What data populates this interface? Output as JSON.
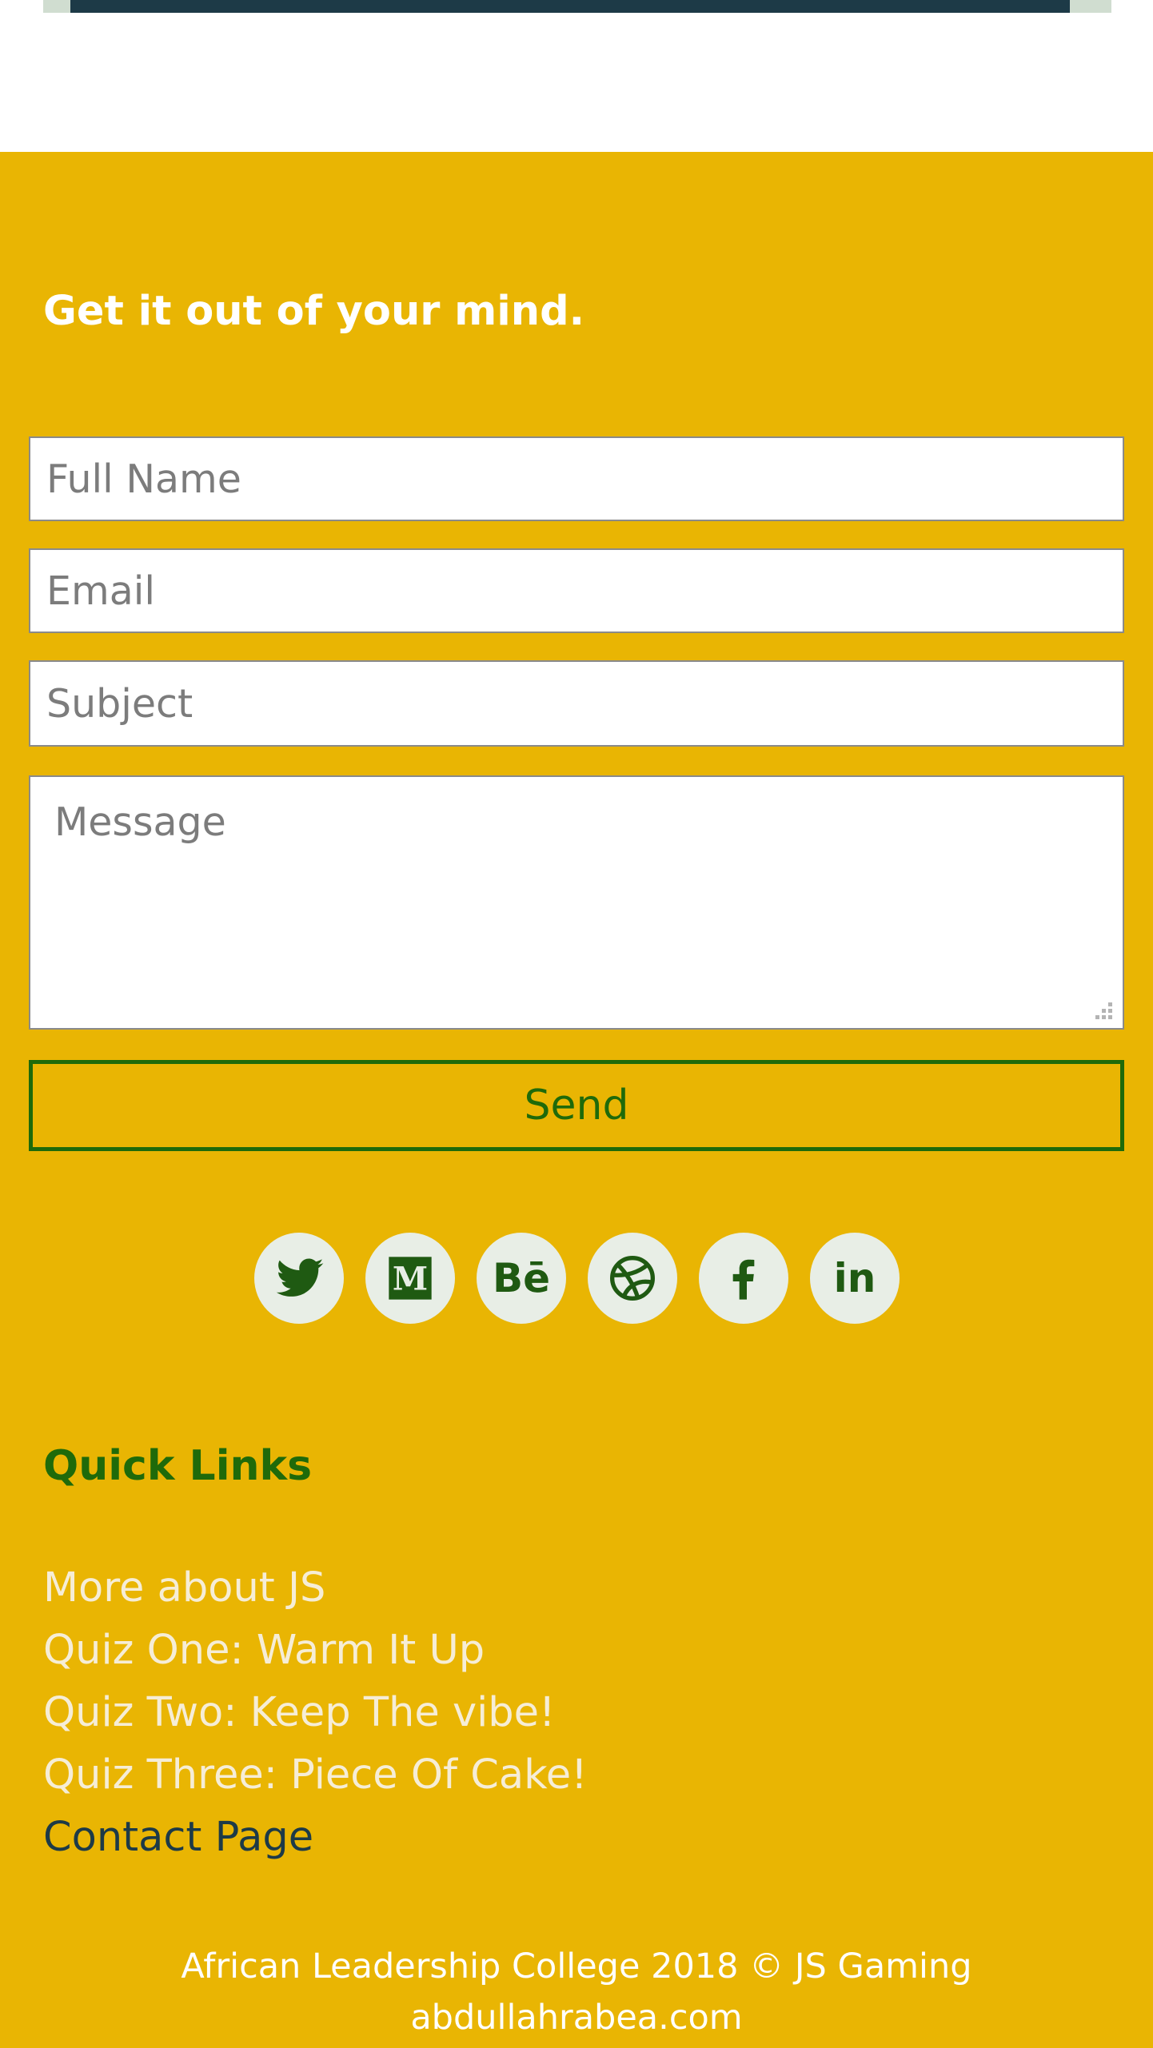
{
  "contact": {
    "heading": "Get it out of your mind.",
    "fields": {
      "name_placeholder": "Full Name",
      "email_placeholder": "Email",
      "subject_placeholder": "Subject",
      "message_placeholder": "Message"
    },
    "send_label": "Send"
  },
  "socials": [
    {
      "name": "twitter",
      "icon": "twitter-icon"
    },
    {
      "name": "medium",
      "icon": "medium-icon",
      "glyph": "M"
    },
    {
      "name": "behance",
      "icon": "behance-icon",
      "glyph": "Bē"
    },
    {
      "name": "dribbble",
      "icon": "dribbble-icon"
    },
    {
      "name": "facebook",
      "icon": "facebook-icon"
    },
    {
      "name": "linkedin",
      "icon": "linkedin-icon",
      "glyph": "in"
    }
  ],
  "quick_links": {
    "title": "Quick Links",
    "items": [
      {
        "label": "More about JS"
      },
      {
        "label": "Quiz One: Warm It Up"
      },
      {
        "label": "Quiz Two: Keep The vibe!"
      },
      {
        "label": "Quiz Three: Piece Of Cake!"
      },
      {
        "label": "Contact Page",
        "active": true
      }
    ]
  },
  "footer": {
    "copyright": "African Leadership College 2018 © JS Gaming",
    "site": "abdullahrabea.com"
  },
  "colors": {
    "background": "#e9b503",
    "accent_green": "#1f6a0a",
    "dark_navy": "#1d3a47",
    "social_bg": "#e8eee6"
  }
}
